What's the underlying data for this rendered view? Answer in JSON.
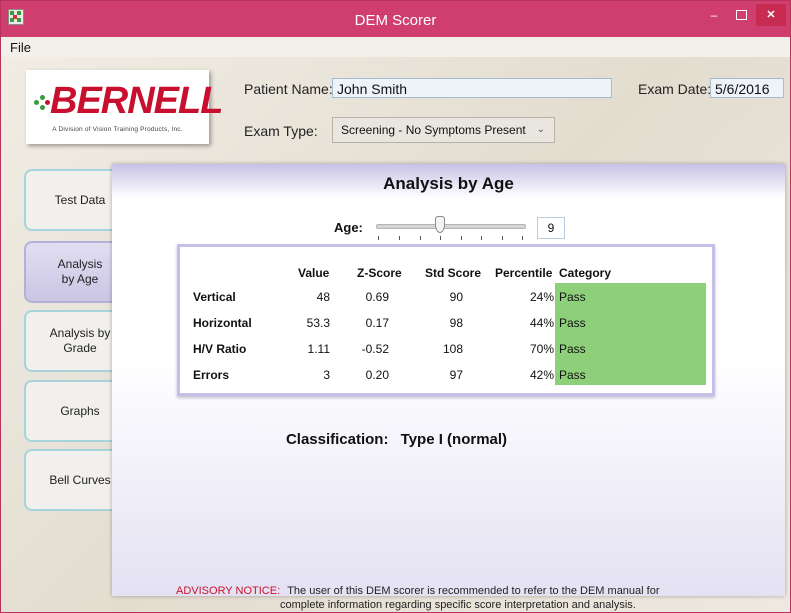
{
  "window": {
    "title": "DEM Scorer",
    "minimize": "–",
    "close": "✕"
  },
  "menu": {
    "file": "File"
  },
  "logo": {
    "name": "BERNELL",
    "tagline": "A Division of Vision Training Products, Inc."
  },
  "patient": {
    "name_label": "Patient Name:",
    "name_value": "John Smith"
  },
  "exam": {
    "date_label": "Exam Date:",
    "date_value": "5/6/2016",
    "type_label": "Exam Type:",
    "type_value": "Screening - No Symptoms Present"
  },
  "tabs": [
    {
      "label": "Test Data",
      "active": false
    },
    {
      "label": "Analysis by Age",
      "active": true
    },
    {
      "label": "Analysis by Grade",
      "active": false
    },
    {
      "label": "Graphs",
      "active": false
    },
    {
      "label": "Bell Curves",
      "active": false
    }
  ],
  "panel": {
    "title": "Analysis by Age",
    "age_label": "Age:",
    "age_value": "9",
    "columns": [
      "Value",
      "Z-Score",
      "Std Score",
      "Percentile",
      "Category"
    ],
    "rows": [
      {
        "label": "Vertical",
        "value": "48",
        "z": "0.69",
        "std": "90",
        "pct": "24%",
        "cat": "Pass"
      },
      {
        "label": "Horizontal",
        "value": "53.3",
        "z": "0.17",
        "std": "98",
        "pct": "44%",
        "cat": "Pass"
      },
      {
        "label": "H/V Ratio",
        "value": "1.11",
        "z": "-0.52",
        "std": "108",
        "pct": "70%",
        "cat": "Pass"
      },
      {
        "label": "Errors",
        "value": "3",
        "z": "0.20",
        "std": "97",
        "pct": "42%",
        "cat": "Pass"
      }
    ],
    "classification_label": "Classification:",
    "classification_value": "Type I (normal)"
  },
  "advisory": {
    "head": "ADVISORY NOTICE:",
    "line1": "The user of this DEM scorer is recommended to refer to the DEM manual for",
    "line2": "complete information regarding specific score interpretation and analysis."
  },
  "colors": {
    "accent": "#cf3e6e",
    "pass": "#8ed07a",
    "tab_active": "#c9c5e4"
  }
}
